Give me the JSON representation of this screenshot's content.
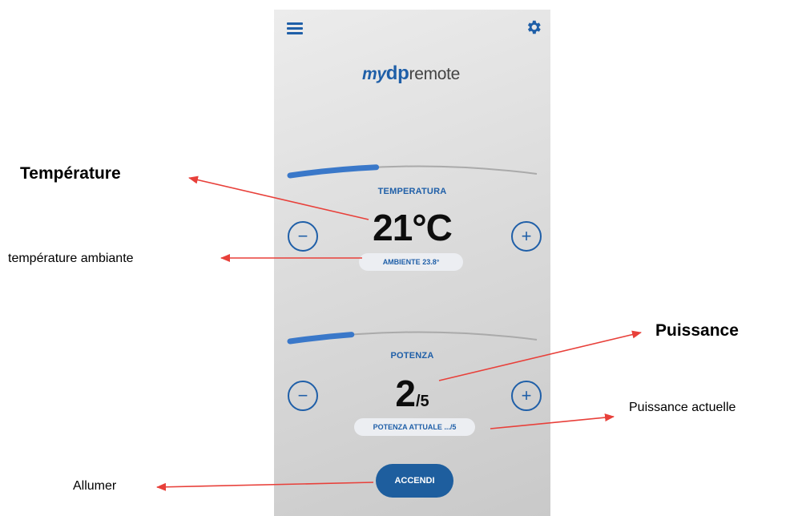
{
  "app": {
    "logo": {
      "my": "my",
      "dp": "dp",
      "remote": "remote"
    },
    "temperature": {
      "label": "TEMPERATURA",
      "value": "21°C",
      "ambient": "AMBIENTE 23.8°",
      "slider_level": 0.35,
      "minus": "−",
      "plus": "+"
    },
    "power": {
      "label": "POTENZA",
      "value_main": "2",
      "value_sub": "/5",
      "current": "POTENZA ATTUALE .../5",
      "slider_level": 0.25,
      "minus": "−",
      "plus": "+"
    },
    "button": {
      "accendi": "ACCENDI"
    }
  },
  "annotations": {
    "temperature": "Température",
    "ambient": "température ambiante",
    "power": "Puissance",
    "current_power": "Puissance actuelle",
    "turn_on": "Allumer"
  },
  "icons": [
    "menu-icon",
    "gear-icon",
    "minus-icon",
    "plus-icon"
  ],
  "colors": {
    "accent": "#1f5fa8",
    "button": "#1e5e9e",
    "arrow": "#e8403a",
    "slider_track": "#aaaaaa",
    "slider_fill": "#3a78c9"
  }
}
